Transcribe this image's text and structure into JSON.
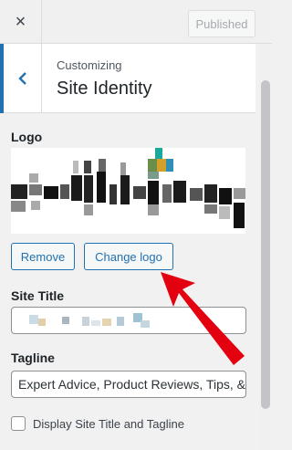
{
  "topbar": {
    "close_icon": "×",
    "publish_label": "Published"
  },
  "section": {
    "breadcrumb": "Customizing",
    "title": "Site Identity"
  },
  "logo": {
    "label": "Logo",
    "remove_label": "Remove",
    "change_label": "Change logo"
  },
  "site_title": {
    "label": "Site Title"
  },
  "tagline": {
    "label": "Tagline",
    "value": "Expert Advice, Product Reviews, Tips, & Tricks"
  },
  "display_option": {
    "label": "Display Site Title and Tagline",
    "checked": false
  },
  "colors": {
    "accent": "#2271b1",
    "arrow": "#e3000f"
  }
}
